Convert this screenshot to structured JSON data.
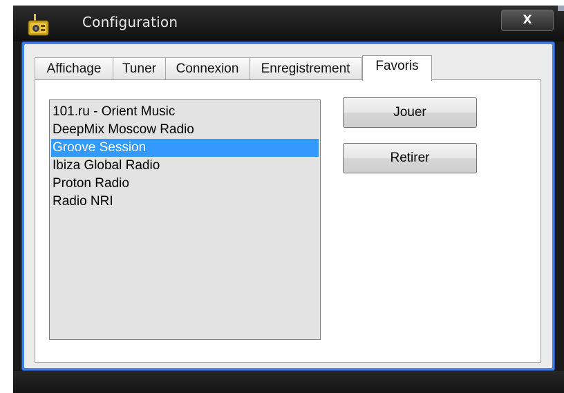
{
  "window": {
    "title": "Configuration",
    "close_label": "X",
    "app_icon": "radio-icon"
  },
  "tabs": [
    {
      "label": "Affichage",
      "active": false
    },
    {
      "label": "Tuner",
      "active": false
    },
    {
      "label": "Connexion",
      "active": false
    },
    {
      "label": "Enregistrement",
      "active": false
    },
    {
      "label": "Favoris",
      "active": true
    }
  ],
  "favorites": {
    "items": [
      {
        "label": "101.ru - Orient Music",
        "selected": false
      },
      {
        "label": "DeepMix Moscow Radio",
        "selected": false
      },
      {
        "label": "Groove Session",
        "selected": true
      },
      {
        "label": "Ibiza Global Radio",
        "selected": false
      },
      {
        "label": "Proton Radio",
        "selected": false
      },
      {
        "label": "Radio NRI",
        "selected": false
      }
    ],
    "play_label": "Jouer",
    "remove_label": "Retirer"
  },
  "colors": {
    "frame_accent": "#3d80e6",
    "selection": "#3399ff",
    "titlebar": "#1a1a1a"
  }
}
